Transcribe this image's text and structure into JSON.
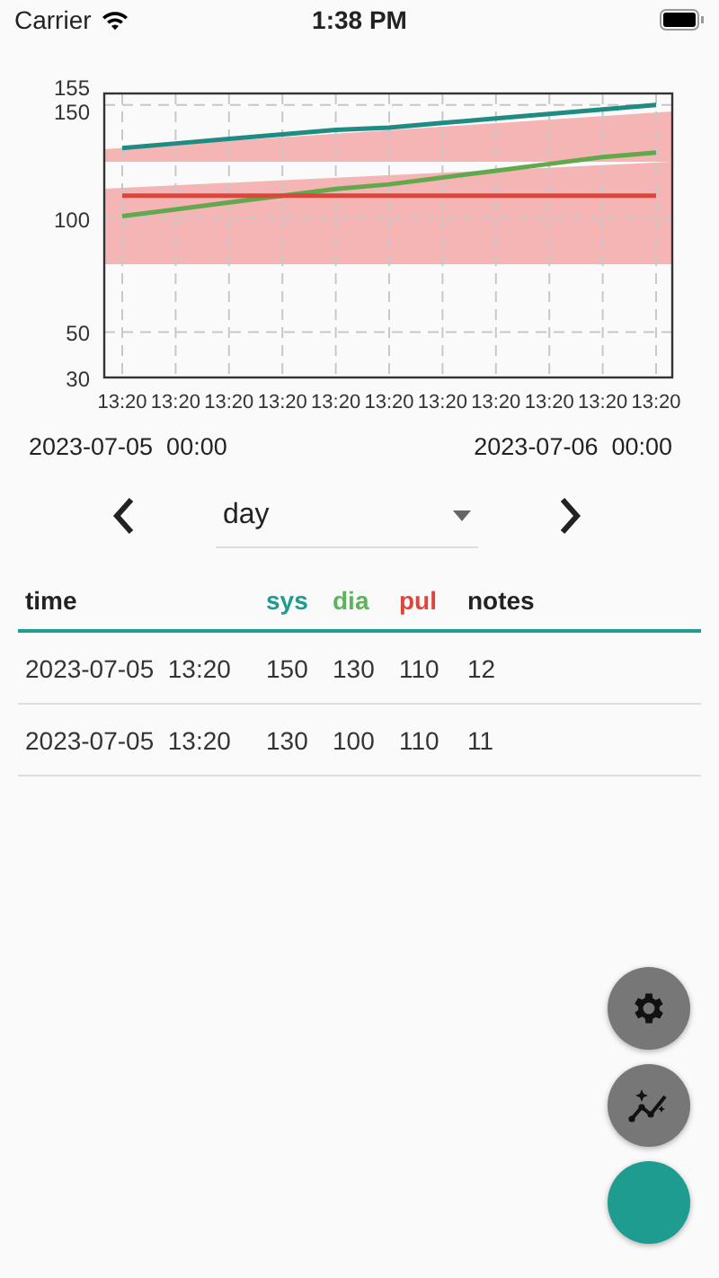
{
  "status_bar": {
    "carrier": "Carrier",
    "time": "1:38 PM"
  },
  "chart": {
    "chart_data": {
      "type": "line",
      "grid": true,
      "ylim": [
        30,
        155
      ],
      "yticks": [
        30,
        50,
        100,
        150,
        155
      ],
      "categories": [
        "13:20",
        "13:20",
        "13:20",
        "13:20",
        "13:20",
        "13:20",
        "13:20",
        "13:20",
        "13:20",
        "13:20",
        "13:20"
      ],
      "series": [
        {
          "color": "#1e8c82",
          "values": [
            131,
            133,
            135,
            137,
            139,
            140,
            142,
            144,
            146,
            148,
            150
          ]
        },
        {
          "color": "#62a84c",
          "values": [
            101,
            104,
            107,
            110,
            113,
            115,
            118,
            121,
            124,
            127,
            129
          ]
        },
        {
          "color": "#e0453a",
          "values": [
            110,
            110,
            110,
            110,
            110,
            110,
            110,
            110,
            110,
            110,
            110
          ]
        }
      ]
    },
    "range_start": "2023-07-05  00:00",
    "range_end": "2023-07-06  00:00"
  },
  "period": {
    "value": "day"
  },
  "table": {
    "columns": [
      {
        "label": "time",
        "color": "#222222"
      },
      {
        "label": "sys",
        "color": "#1e9c90"
      },
      {
        "label": "dia",
        "color": "#5db55a"
      },
      {
        "label": "pul",
        "color": "#e0453a"
      },
      {
        "label": "notes",
        "color": "#222222"
      }
    ],
    "rows": [
      [
        "2023-07-05  13:20",
        "150",
        "130",
        "110",
        "12"
      ],
      [
        "2023-07-05  13:20",
        "130",
        "100",
        "110",
        "11"
      ]
    ]
  },
  "fabs": [
    {
      "kind": "settings",
      "color": "#777777"
    },
    {
      "kind": "chart",
      "color": "#777777"
    },
    {
      "kind": "blank",
      "color": "#1e9c90"
    }
  ]
}
